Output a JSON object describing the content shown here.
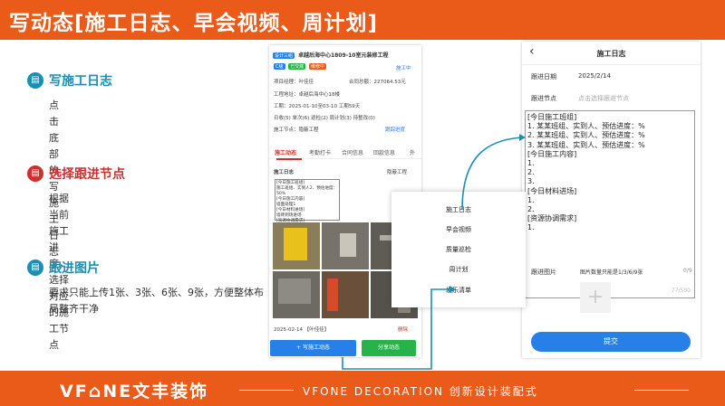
{
  "header": {
    "title": "写动态[施工日志、早会视频、周计划]"
  },
  "steps": [
    {
      "title": "写施工日志",
      "desc": "点击 底部的 写施工日志"
    },
    {
      "title": "选择跟进节点",
      "desc": "根据当前施工进度，选择对应的施工节点"
    },
    {
      "title": "跟进图片",
      "desc": "要求只能上传1张、3张、6张、9张，方便整体布局整齐干净"
    }
  ],
  "middle_phone": {
    "badges": [
      "设计三组",
      "C级",
      "已交底",
      "维修中"
    ],
    "project_title": "卓越后海中心1809-10室元装修工程",
    "construction_center": "施工中",
    "manager": "项目经理：叶佳佳",
    "contract_total": "合同总额：227064.53元",
    "address": "工程地址：卓越后海中心18楼",
    "period": "工期：2025-01-10至03-10 工期59天",
    "counts": "日收(5)  单次(6)  巡检(2)  周计划(3)  待整改(0)",
    "node": "施工节点：隐蔽工程",
    "node_link": "跟踪进度",
    "tabs": [
      "施工动态",
      "考勤打卡",
      "合同信息",
      "回款信息",
      "外"
    ],
    "log_title": "施工日志",
    "log_node": "隐蔽工程",
    "log_text": [
      "[今日施工班组]",
      "施工班组、实到人2、预估进度：50%",
      "[今日施工内容]",
      "墙面处理1",
      "[今日材料进场]",
      "墙砖到场进场",
      "[资源协调需求]"
    ],
    "log_date": "2025-02-14 【叶佳佳】",
    "delete": "删除",
    "write_btn": "+ 写施工动态",
    "share_btn": "分享动态"
  },
  "menu": {
    "items": [
      "施工日志",
      "早会视频",
      "质量巡检",
      "周计划",
      "发乐清单"
    ]
  },
  "right_phone": {
    "nav_title": "施工日志",
    "date_label": "跟进日期",
    "date_value": "2025/2/14",
    "node_label": "跟进节点",
    "node_placeholder": "点击选择跟进节点",
    "content_lines": [
      "[今日施工班组]",
      "1. 某某班组、实到人、预估进度：%",
      "2. 某某班组、实到人、预估进度：%",
      "3. 某某班组、实到人、预估进度：%",
      "[今日施工内容]",
      "1.",
      "2.",
      "3.",
      "[今日材料进场]",
      "1.",
      "2.",
      "[资源协调需求]",
      "1."
    ],
    "counter": "77/500",
    "photo_label": "跟进图片",
    "photo_hint": "图片数量只能是1/3/6/9张",
    "photo_count": "0/9",
    "submit": "提交"
  },
  "footer": {
    "brand": "VF⌂NE文丰装饰",
    "tagline": "VFONE DECORATION 创新设计装配式"
  },
  "colors": {
    "accent": "#ea5b1a",
    "teal": "#1b8fb3",
    "red": "#d12e2e",
    "primary_blue": "#2680e8",
    "green": "#27b24a"
  }
}
